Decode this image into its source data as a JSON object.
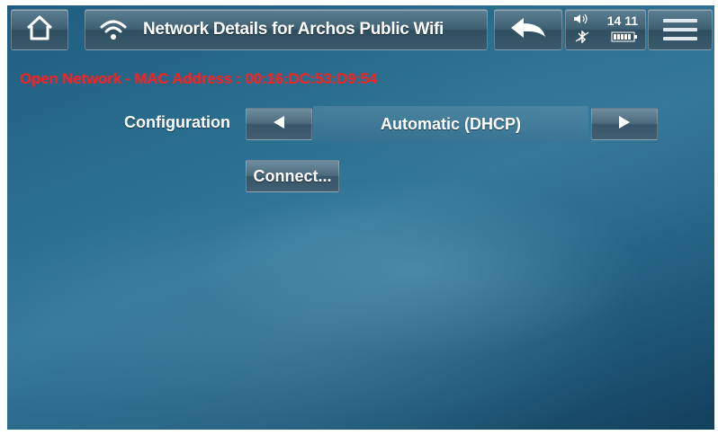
{
  "header": {
    "title": "Network Details for Archos Public Wifi",
    "home_icon": "home-icon",
    "wifi_icon": "wifi-icon",
    "back_icon": "back-arrow-icon",
    "menu_icon": "menu-icon"
  },
  "status": {
    "time": "14 11",
    "volume_icon": "volume-icon",
    "bluetooth_icon": "bluetooth-off-icon",
    "battery_icon": "battery-icon"
  },
  "network": {
    "info_line": "Open Network - MAC Address : 00:16:DC:53:D9:54",
    "info_color": "#ff1f1f"
  },
  "configuration": {
    "label": "Configuration",
    "value": "Automatic (DHCP)",
    "prev_icon": "arrow-left-icon",
    "next_icon": "arrow-right-icon"
  },
  "actions": {
    "connect_label": "Connect..."
  }
}
